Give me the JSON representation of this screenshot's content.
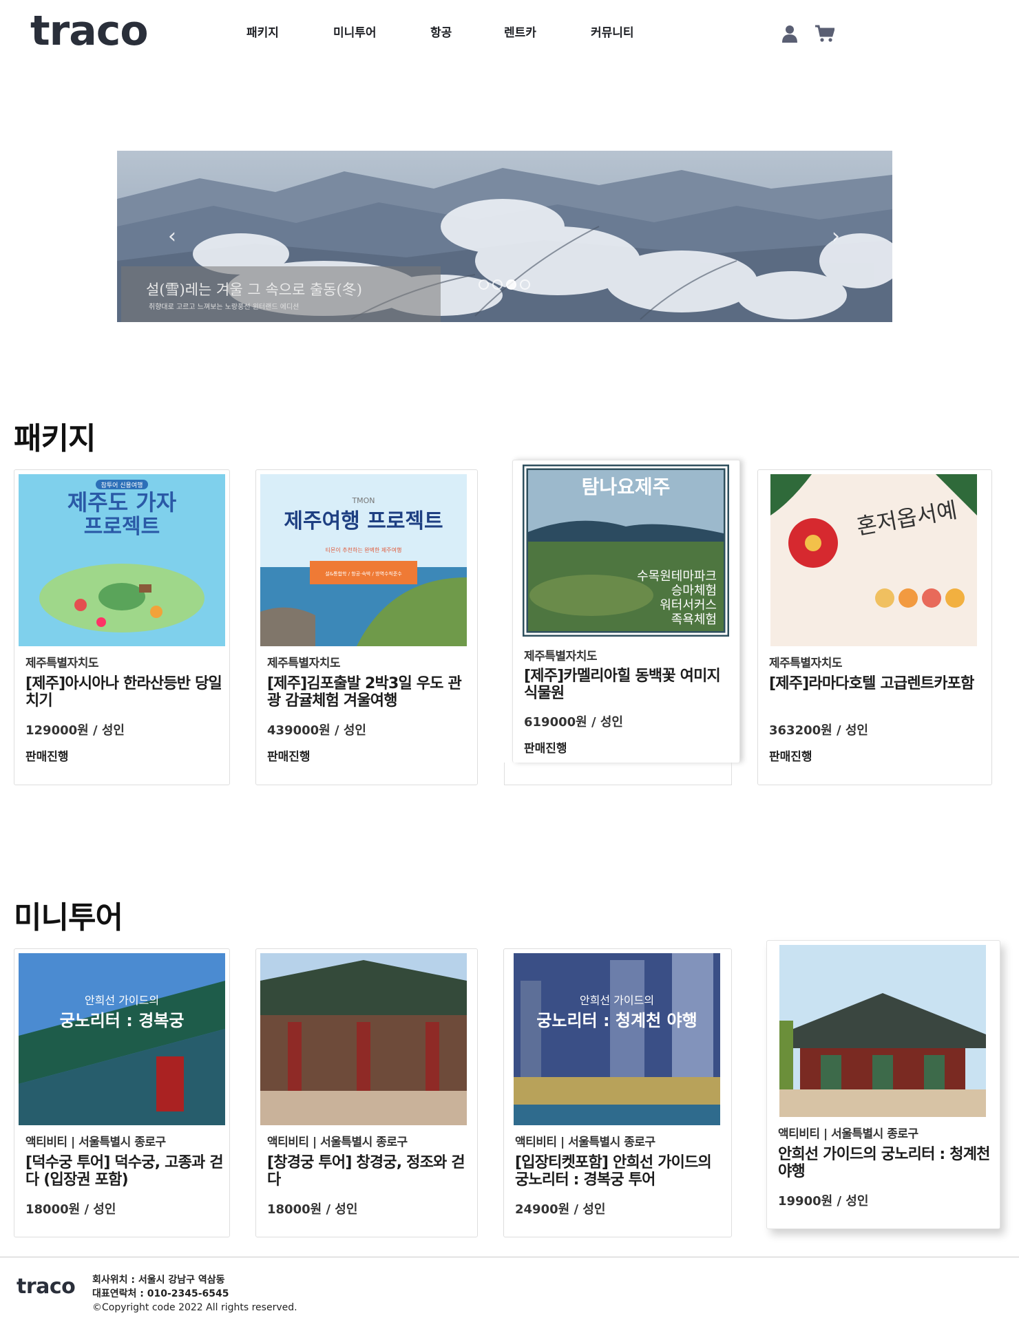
{
  "header": {
    "logo": "traco",
    "nav": [
      "패키지",
      "미니투어",
      "항공",
      "렌트카",
      "커뮤니티"
    ],
    "icons": [
      "user-icon",
      "cart-icon"
    ]
  },
  "banner": {
    "title": "설(雪)레는 겨울 그 속으로 출동(冬)",
    "subtitle": "취향대로 고르고 느껴보는 노랑풍선 윈터랜드 에디션",
    "dots": 4,
    "active_dot": 3,
    "prev_icon": "chevron-left-icon",
    "next_icon": "chevron-right-icon"
  },
  "packages": {
    "title": "패키지",
    "cards": [
      {
        "img_text": [
          "제주도 가자",
          "프로젝트"
        ],
        "img_badge": "참투어 신용여행",
        "region": "제주특별자치도",
        "name": "[제주]아시아나 한라산등반 당일치기",
        "price": "129000원 / 성인",
        "status": "판매진행"
      },
      {
        "img_text": [
          "TMON",
          "제주여행 프로젝트",
          "티몬이 추천하는 완벽한 제주여행"
        ],
        "img_badge": "설&통합학 / 항공·숙박 / 방역수칙준수",
        "region": "제주특별자치도",
        "name": "[제주]김포출발 2박3일 우도 관광 감귤체험 겨울여행",
        "price": "439000원 / 성인",
        "status": "판매진행"
      },
      {
        "img_text": [
          "탐나요제주",
          "수목원테마파크",
          "승마체험",
          "워터서커스",
          "족욕체험"
        ],
        "region": "제주특별자치도",
        "name": "[제주]카멜리아힐 동백꽃 여미지식물원",
        "price": "619000원 / 성인",
        "status": "판매진행"
      },
      {
        "img_text": [
          "혼저옵서예"
        ],
        "region": "제주특별자치도",
        "name": "[제주]라마다호텔 고급렌트카포함",
        "price": "363200원 / 성인",
        "status": "판매진행"
      }
    ]
  },
  "minitours": {
    "title": "미니투어",
    "cards": [
      {
        "img_text": [
          "안희선 가이드의",
          "궁노리터 : 경복궁"
        ],
        "region": "액티비티 | 서울특별시 종로구",
        "name": "[덕수궁 투어] 덕수궁, 고종과 걷다 (입장권 포함)",
        "price": "18000원 / 성인"
      },
      {
        "img_text": [],
        "region": "액티비티 | 서울특별시 종로구",
        "name": "[창경궁 투어] 창경궁, 정조와 걷다",
        "price": "18000원 / 성인"
      },
      {
        "img_text": [
          "안희선 가이드의",
          "궁노리터 : 청계천 야행"
        ],
        "region": "액티비티 | 서울특별시 종로구",
        "name": "[입장티켓포함] 안희선 가이드의 궁노리터 : 경복궁 투어",
        "price": "24900원 / 성인"
      },
      {
        "img_text": [],
        "region": "액티비티 | 서울특별시 종로구",
        "name": "안희선 가이드의 궁노리터 : 청계천 야행",
        "price": "19900원 / 성인"
      }
    ]
  },
  "footer": {
    "logo": "traco",
    "address": "회사위치 : 서울시 강남구 역삼동",
    "contact": "대표연락처 : 010-2345-6545",
    "copyright": "©Copyright code 2022 All rights reserved."
  }
}
